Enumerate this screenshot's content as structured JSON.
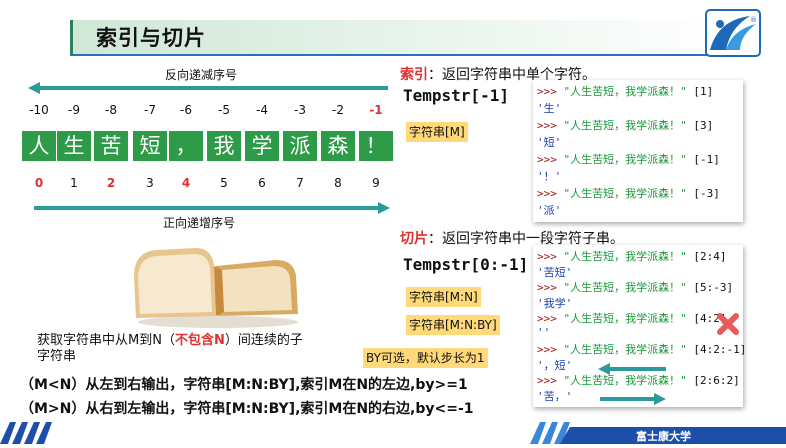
{
  "header": {
    "title": "索引与切片",
    "logo_icon": "university-logo-icon"
  },
  "sequence": {
    "reverse_label": "反向递减序号",
    "forward_label": "正向递增序号",
    "neg_indices": [
      "-10",
      "-9",
      "-8",
      "-7",
      "-6",
      "-5",
      "-4",
      "-3",
      "-2",
      "-1"
    ],
    "chars": [
      "人",
      "生",
      "苦",
      "短",
      "，",
      "我",
      "学",
      "派",
      "森",
      "！"
    ],
    "pos_indices": [
      "0",
      "1",
      "2",
      "3",
      "4",
      "5",
      "6",
      "7",
      "8",
      "9"
    ],
    "highlight_color": "#e03030",
    "cell_color": "#2e9b49"
  },
  "image_icon": "bread-slices-image",
  "slice_desc": {
    "line1_pre": "获取字符串中从M到N（",
    "line1_red": "不包含N",
    "line1_post": "）间连续的子",
    "line2": "字符串"
  },
  "index_section": {
    "heading_red": "索引",
    "heading_rest": "：返回字符串中单个字符。",
    "syntax": "Tempstr[-1]",
    "tag": "字符串[M]",
    "console": [
      {
        "prompt": ">>>",
        "string": "\"人生苦短，我学派森！\"",
        "index": "[1]",
        "result": "'生'"
      },
      {
        "prompt": ">>>",
        "string": "\"人生苦短，我学派森！\"",
        "index": "[3]",
        "result": "'短'"
      },
      {
        "prompt": ">>>",
        "string": "\"人生苦短，我学派森！\"",
        "index": "[-1]",
        "result": "'！'"
      },
      {
        "prompt": ">>>",
        "string": "\"人生苦短，我学派森！\"",
        "index": "[-3]",
        "result": "'派'"
      }
    ]
  },
  "slice_section": {
    "heading_red": "切片",
    "heading_rest": "：返回字符串中一段字符子串。",
    "syntax": "Tempstr[0:-1]",
    "tags": [
      "字符串[M:N]",
      "字符串[M:N:BY]"
    ],
    "by_note": "BY可选，默认步长为1",
    "console": [
      {
        "prompt": ">>>",
        "string": "\"人生苦短，我学派森！\"",
        "index": "[2:4]",
        "result": "'苦短'"
      },
      {
        "prompt": ">>>",
        "string": "\"人生苦短，我学派森！\"",
        "index": "[5:-3]",
        "result": "'我学'"
      },
      {
        "prompt": ">>>",
        "string": "\"人生苦短，我学派森！\"",
        "index": "[4:2]",
        "result": "''"
      },
      {
        "prompt": ">>>",
        "string": "\"人生苦短，我学派森！\"",
        "index": "[4:2:-1]",
        "result": "'，短'"
      },
      {
        "prompt": ">>>",
        "string": "\"人生苦短，我学派森！\"",
        "index": "[2:6:2]",
        "result": "'苦，'"
      }
    ]
  },
  "rules": [
    "（M<N）从左到右输出，字符串[M:N:BY],索引M在N的左边,by>=1",
    "（M>N）从右到左输出，字符串[M:N:BY],索引M在N的右边,by<=-1"
  ],
  "footer": {
    "university": "富士康大学"
  }
}
